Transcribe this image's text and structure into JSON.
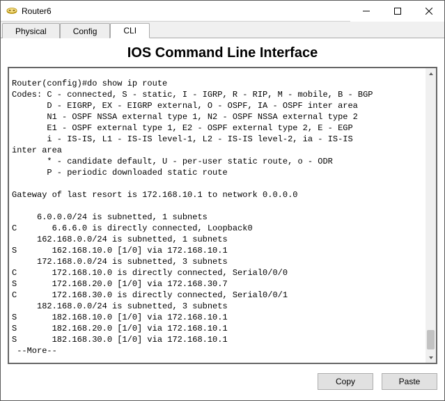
{
  "window": {
    "title": "Router6"
  },
  "tabs": {
    "items": [
      {
        "label": "Physical"
      },
      {
        "label": "Config"
      },
      {
        "label": "CLI"
      }
    ],
    "activeIndex": 2
  },
  "cli": {
    "heading": "IOS Command Line Interface",
    "lines": [
      "Router(config)#do show ip route",
      "Codes: C - connected, S - static, I - IGRP, R - RIP, M - mobile, B - BGP",
      "       D - EIGRP, EX - EIGRP external, O - OSPF, IA - OSPF inter area",
      "       N1 - OSPF NSSA external type 1, N2 - OSPF NSSA external type 2",
      "       E1 - OSPF external type 1, E2 - OSPF external type 2, E - EGP",
      "       i - IS-IS, L1 - IS-IS level-1, L2 - IS-IS level-2, ia - IS-IS",
      "inter area",
      "       * - candidate default, U - per-user static route, o - ODR",
      "       P - periodic downloaded static route",
      "",
      "Gateway of last resort is 172.168.10.1 to network 0.0.0.0",
      "",
      "     6.0.0.0/24 is subnetted, 1 subnets",
      "C       6.6.6.0 is directly connected, Loopback0",
      "     162.168.0.0/24 is subnetted, 1 subnets",
      "S       162.168.10.0 [1/0] via 172.168.10.1",
      "     172.168.0.0/24 is subnetted, 3 subnets",
      "C       172.168.10.0 is directly connected, Serial0/0/0",
      "S       172.168.20.0 [1/0] via 172.168.30.7",
      "C       172.168.30.0 is directly connected, Serial0/0/1",
      "     182.168.0.0/24 is subnetted, 3 subnets",
      "S       182.168.10.0 [1/0] via 172.168.10.1",
      "S       182.168.20.0 [1/0] via 172.168.10.1",
      "S       182.168.30.0 [1/0] via 172.168.10.1",
      " --More--"
    ]
  },
  "buttons": {
    "copy": "Copy",
    "paste": "Paste"
  }
}
